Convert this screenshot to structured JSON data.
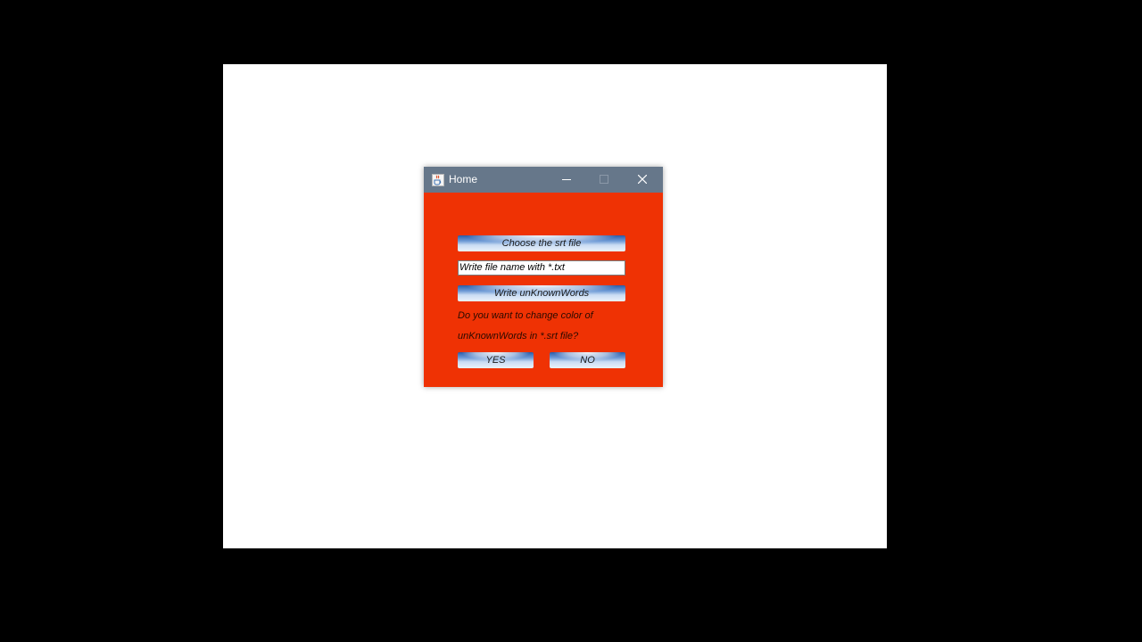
{
  "window": {
    "title": "Home",
    "app_icon": "java-cup-icon",
    "controls": {
      "minimize": "minimize-icon",
      "maximize": "maximize-icon",
      "close": "close-icon"
    }
  },
  "form": {
    "choose_button_label": "Choose the srt file",
    "file_name_value": "Write file name with *.txt",
    "write_button_label": "Write unKnownWords",
    "question_line1": "Do you want to change color of",
    "question_line2": "unKnownWords in *.srt file?",
    "yes_label": "YES",
    "no_label": "NO"
  },
  "colors": {
    "desktop": "#000000",
    "screen": "#ffffff",
    "titlebar": "#66778a",
    "window_content": "#ef3204"
  }
}
